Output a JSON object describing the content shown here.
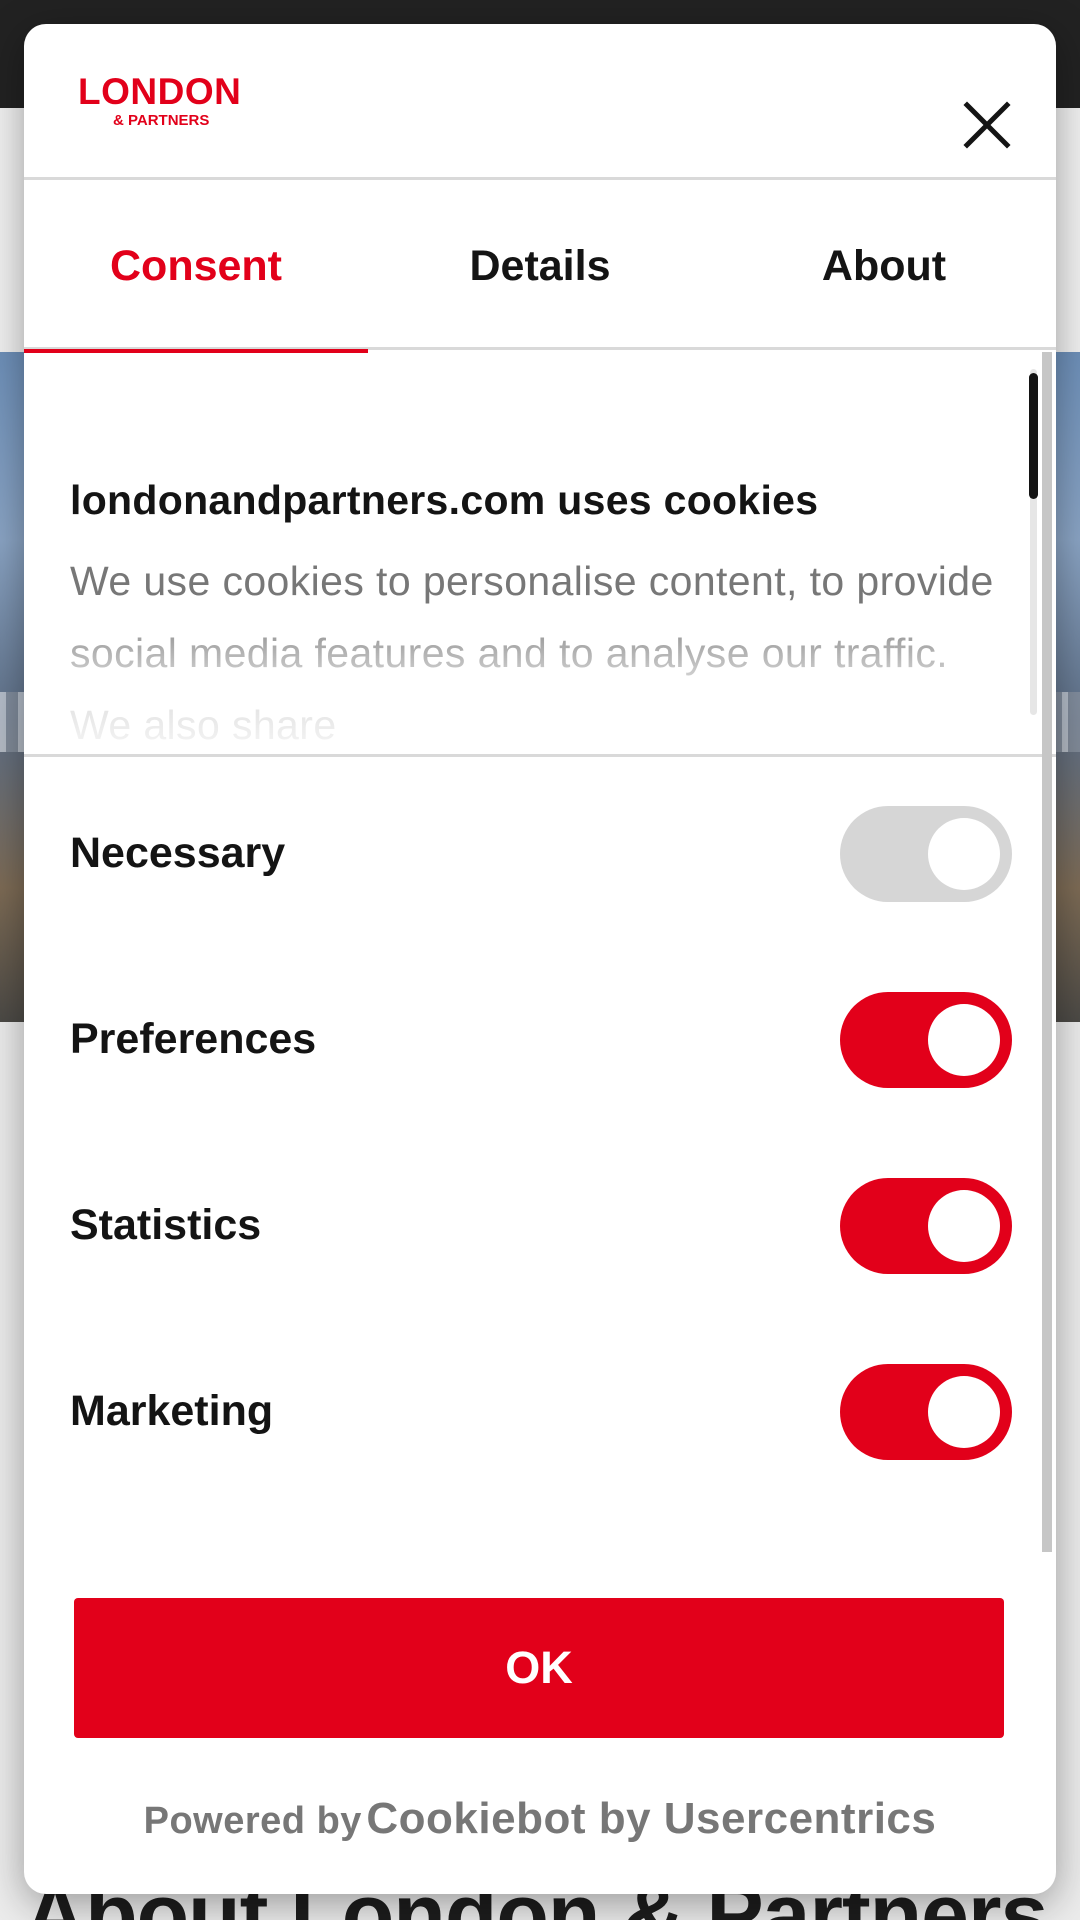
{
  "background": {
    "heading": "About London & Partners"
  },
  "dialog": {
    "logo": {
      "main": "LONDON",
      "sub": "& PARTNERS"
    },
    "close_icon": "close-icon",
    "tabs": [
      {
        "label": "Consent",
        "active": true
      },
      {
        "label": "Details",
        "active": false
      },
      {
        "label": "About",
        "active": false
      }
    ],
    "intro": {
      "title": "londonandpartners.com uses cookies",
      "body": "We use cookies to personalise content, to provide social media features and to analyse our traffic. We also share"
    },
    "consents": [
      {
        "label": "Necessary",
        "enabled": true,
        "locked": true
      },
      {
        "label": "Preferences",
        "enabled": true,
        "locked": false
      },
      {
        "label": "Statistics",
        "enabled": true,
        "locked": false
      },
      {
        "label": "Marketing",
        "enabled": true,
        "locked": false
      }
    ],
    "ok_label": "OK",
    "footer": {
      "prefix": "Powered by",
      "brand": "Cookiebot by Usercentrics"
    }
  },
  "colors": {
    "accent": "#e2001a",
    "toggle_disabled": "#d6d6d6",
    "muted_text": "#777777",
    "text": "#141414"
  }
}
